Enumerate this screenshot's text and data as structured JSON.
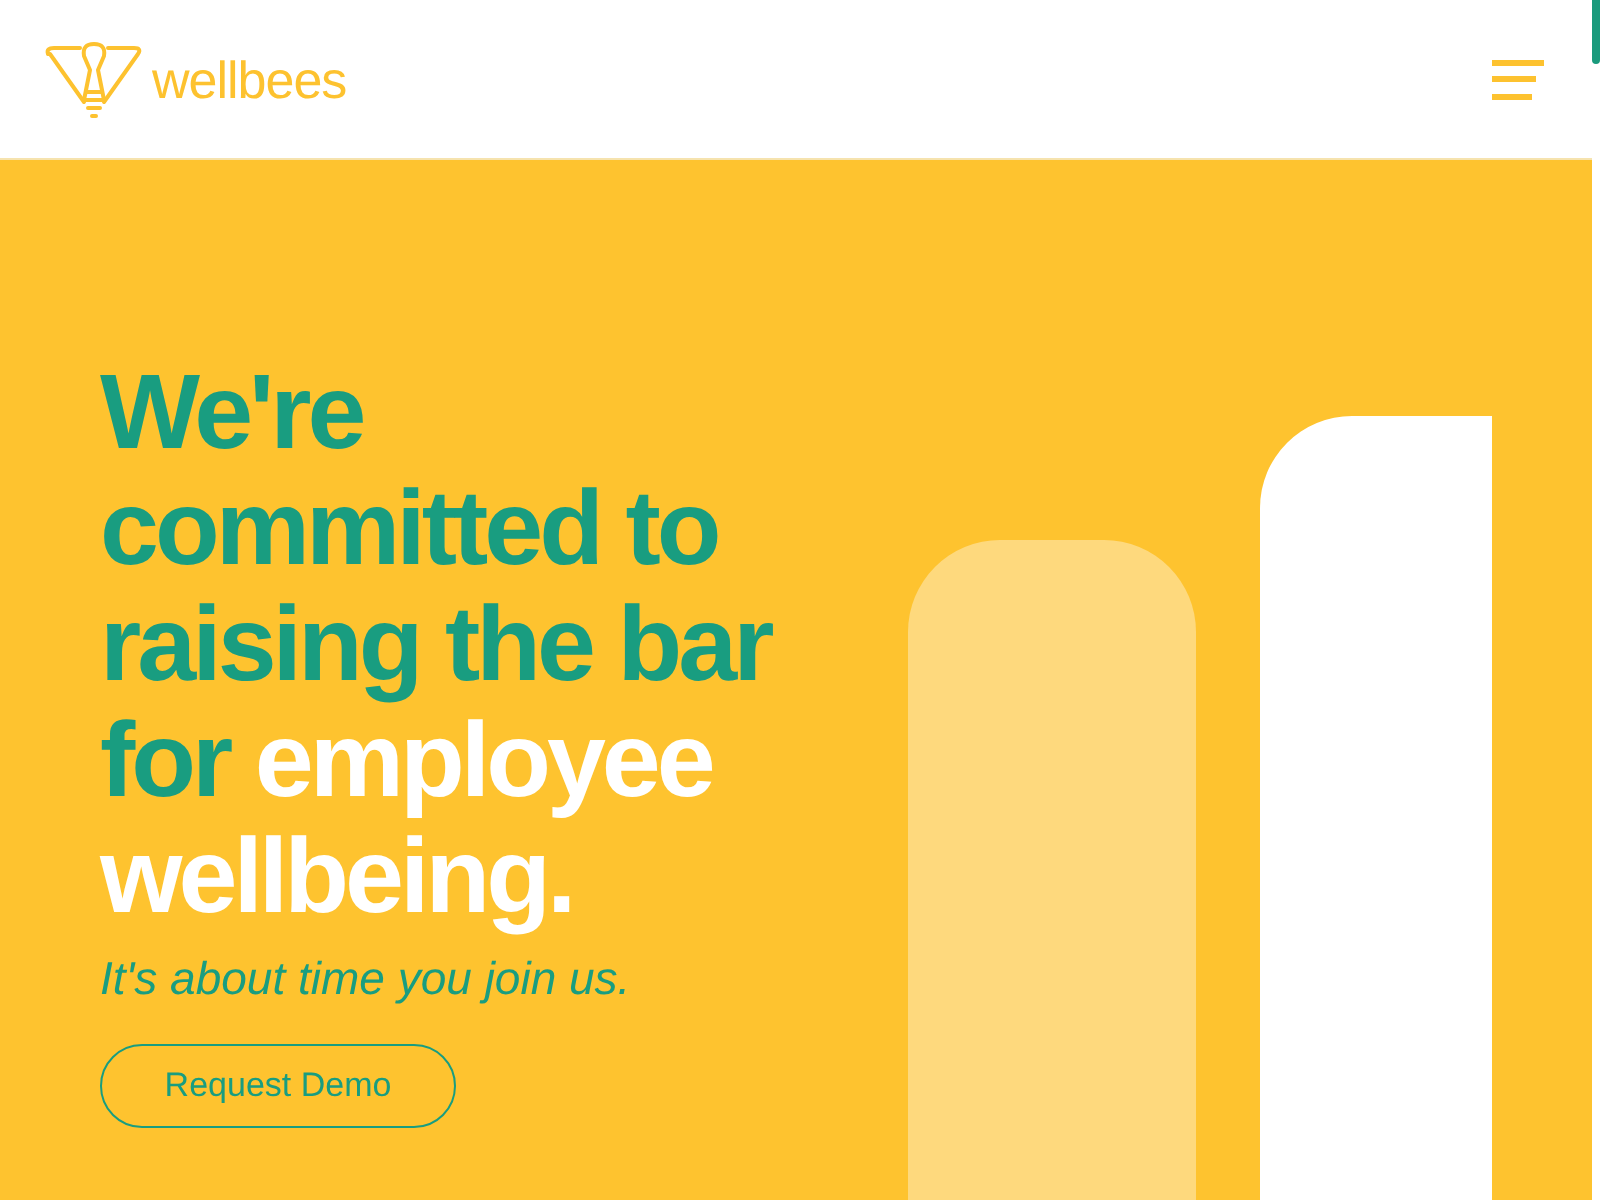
{
  "header": {
    "logo_text": "wellbees"
  },
  "hero": {
    "headline": "We're committed to raising the bar for",
    "headline_highlight": "employee wellbeing.",
    "subtitle": "It's about time you join us.",
    "cta_button": "Request Demo"
  }
}
